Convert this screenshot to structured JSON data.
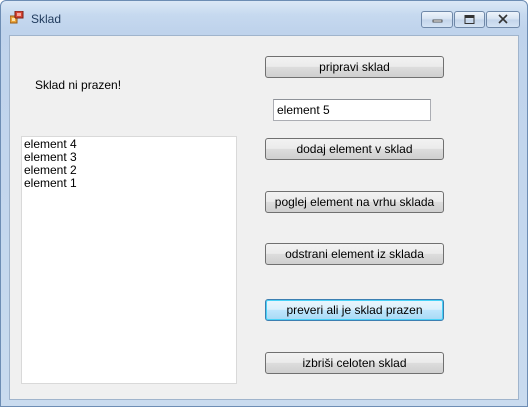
{
  "window": {
    "title": "Sklad"
  },
  "status": {
    "text": "Sklad ni prazen!"
  },
  "stack_list": {
    "items": [
      "element 4",
      "element 3",
      "element 2",
      "element 1"
    ]
  },
  "input": {
    "value": "element 5"
  },
  "buttons": {
    "prepare": "pripravi sklad",
    "push": "dodaj element v sklad",
    "peek": "poglej element na vrhu sklada",
    "pop": "odstrani element iz sklada",
    "check_empty": "preveri ali je sklad prazen",
    "clear": "izbriši celoten sklad"
  },
  "colors": {
    "titlebar": "#c6d9ef",
    "client": "#f0f0f0",
    "focus_border": "#3c7fb1"
  },
  "icons": {
    "app": "app-icon",
    "minimize": "minimize-icon",
    "maximize": "maximize-icon",
    "close": "close-icon"
  }
}
